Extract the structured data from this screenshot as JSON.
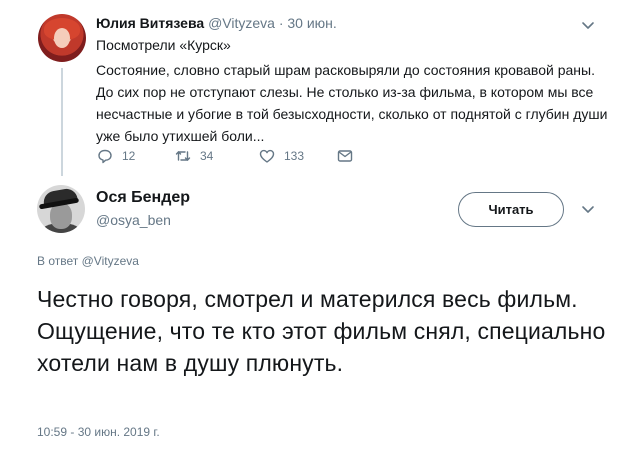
{
  "parent_tweet": {
    "author_name": "Юлия Витязева",
    "handle": "@Vityzeva",
    "separator": "·",
    "date": "30 июн.",
    "line1": "Посмотрели «Курск»",
    "body": "Состояние, словно старый шрам расковыряли до состояния кровавой раны. До сих пор не отступают слезы. Не столько из-за фильма, в котором мы все несчастные и убогие в той безысходности, сколько от поднятой с глубин души уже было утихшей боли...",
    "replies": "12",
    "retweets": "34",
    "likes": "133",
    "icons": [
      "reply-icon",
      "retweet-icon",
      "like-icon",
      "message-icon",
      "chevron-down-icon"
    ]
  },
  "main_tweet": {
    "author_name": "Ося Бендер",
    "handle": "@osya_ben",
    "follow_label": "Читать",
    "reply_prefix": "В ответ",
    "reply_mention": "@Vityzeva",
    "text": "Честно говоря, смотрел и матерился весь фильм. Ощущение, что те кто этот фильм снял, специально хотели нам в душу плюнуть.",
    "timestamp": "10:59 - 30 июн. 2019 г."
  },
  "colors": {
    "text": "#14171a",
    "secondary": "#657786",
    "thread_line": "#ccd6dd"
  }
}
